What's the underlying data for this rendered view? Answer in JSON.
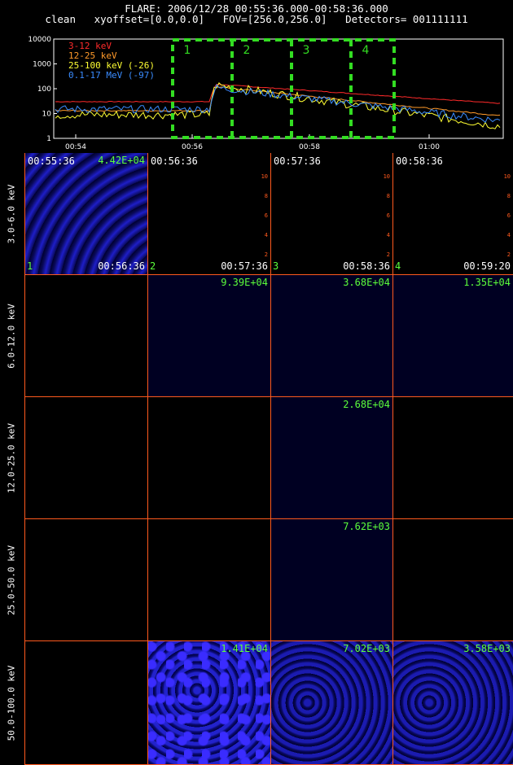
{
  "header": {
    "line1": "FLARE: 2006/12/28 00:55:36.000-00:58:36.000",
    "line2": "clean   xyoffset=[0.0,0.0]   FOV=[256.0,256.0]   Detectors= 001111111"
  },
  "chart_data": {
    "type": "line",
    "x": [
      "00:54",
      "00:56",
      "00:58",
      "01:00"
    ],
    "ylog": true,
    "ylim": [
      1,
      10000
    ],
    "y_ticks": [
      "10000",
      "1000",
      "100",
      "10",
      "1"
    ],
    "series": [
      {
        "name": "3-12 keV",
        "color": "#ff2a2a"
      },
      {
        "name": "12-25 keV",
        "color": "#ff9a2a"
      },
      {
        "name": "25-100 keV (-26)",
        "color": "#ffff33"
      },
      {
        "name": "0.1-17 MeV (-97)",
        "color": "#3a8cff"
      }
    ],
    "interval_labels": [
      "1",
      "2",
      "3",
      "4"
    ]
  },
  "rows": [
    "3.0-6.0 keV",
    "6.0-12.0 keV",
    "12.0-25.0 keV",
    "25.0-50.0 keV",
    "50.0-100.0 keV"
  ],
  "row1": {
    "starts": [
      "00:55:36",
      "00:56:36",
      "00:57:36",
      "00:58:36"
    ],
    "ends": [
      "00:56:36",
      "00:57:36",
      "00:58:36",
      "00:59:20"
    ],
    "nums": [
      "1",
      "2",
      "3",
      "4"
    ],
    "max0": "4.42E+04"
  },
  "maxvals": {
    "r2c1": "9.39E+04",
    "r2c2": "3.68E+04",
    "r2c3": "1.35E+04",
    "r3c2": "2.68E+04",
    "r4c2": "7.62E+03",
    "r5c1": "1.41E+04",
    "r5c2": "7.02E+03",
    "r5c3": "3.58E+03"
  },
  "ticks": [
    "2",
    "4",
    "6",
    "8",
    "10"
  ]
}
